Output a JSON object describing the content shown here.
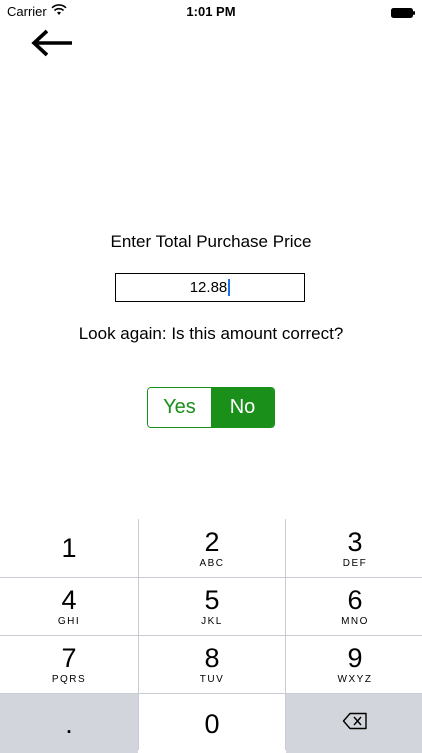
{
  "status_bar": {
    "carrier": "Carrier",
    "time": "1:01 PM"
  },
  "nav": {
    "back_icon": "arrow-left-icon"
  },
  "form": {
    "prompt": "Enter Total Purchase Price",
    "price_value": "12.88",
    "confirm_question": "Look again: Is this amount correct?"
  },
  "toggle": {
    "yes_label": "Yes",
    "no_label": "No",
    "selected": "No",
    "accent_color": "#1a8f1a"
  },
  "keypad": {
    "keys": [
      {
        "digit": "1",
        "letters": ""
      },
      {
        "digit": "2",
        "letters": "ABC"
      },
      {
        "digit": "3",
        "letters": "DEF"
      },
      {
        "digit": "4",
        "letters": "GHI"
      },
      {
        "digit": "5",
        "letters": "JKL"
      },
      {
        "digit": "6",
        "letters": "MNO"
      },
      {
        "digit": "7",
        "letters": "PQRS"
      },
      {
        "digit": "8",
        "letters": "TUV"
      },
      {
        "digit": "9",
        "letters": "WXYZ"
      },
      {
        "digit": ".",
        "letters": ""
      },
      {
        "digit": "0",
        "letters": ""
      }
    ],
    "delete_icon": "backspace-icon"
  }
}
